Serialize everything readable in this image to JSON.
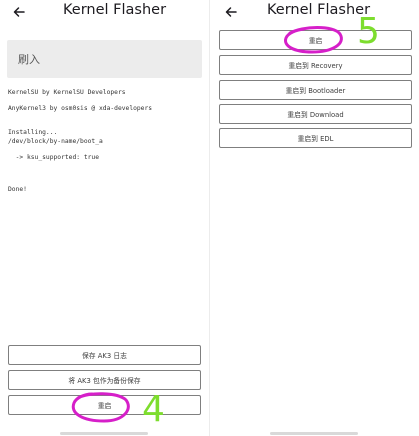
{
  "left_screen": {
    "title": "Kernel Flasher",
    "section_title": "刷入",
    "log_text": "KernelSU by KernelSU Developers\n\nAnyKernel3 by osm0sis @ xda-developers\n\n\nInstalling...\n/dev/block/by-name/boot_a\n\n  -> ksu_supported: true\n\n\n\nDone!",
    "buttons": {
      "save_log": "保存 AK3 日志",
      "save_backup": "将 AK3 包作为备份保存",
      "reboot": "重启"
    },
    "step_marker": "4"
  },
  "right_screen": {
    "title": "Kernel Flasher",
    "buttons": {
      "reboot": "重启",
      "reboot_recovery": "重启到 Recovery",
      "reboot_bootloader": "重启到 Bootloader",
      "reboot_download": "重启到 Download",
      "reboot_edl": "重启到 EDL"
    },
    "step_marker": "5"
  },
  "colors": {
    "annotation_circle": "#d61fc9",
    "annotation_number": "#7ddd2e",
    "section_background": "#ececec",
    "button_border": "#7f7f7f"
  },
  "icons": {
    "back": "arrow-back-icon"
  }
}
